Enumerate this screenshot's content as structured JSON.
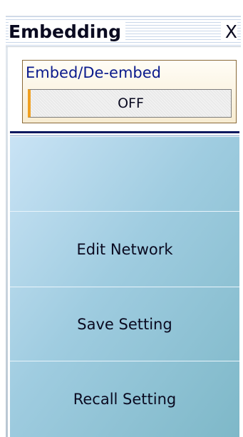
{
  "window": {
    "title": "Embedding",
    "close_label": "X"
  },
  "embed": {
    "label": "Embed/De-embed",
    "value": "OFF"
  },
  "softkeys": [
    {
      "label": ""
    },
    {
      "label": "Edit Network"
    },
    {
      "label": "Save Setting"
    },
    {
      "label": "Recall Setting"
    }
  ],
  "colors": {
    "title_text": "#0a0a20",
    "group_label": "#0a1a8c",
    "separator": "#08185f",
    "toggle_accent": "#f0a020",
    "softkey_gradient_start": "#c9e3f5",
    "softkey_gradient_end": "#7eb8c8"
  }
}
